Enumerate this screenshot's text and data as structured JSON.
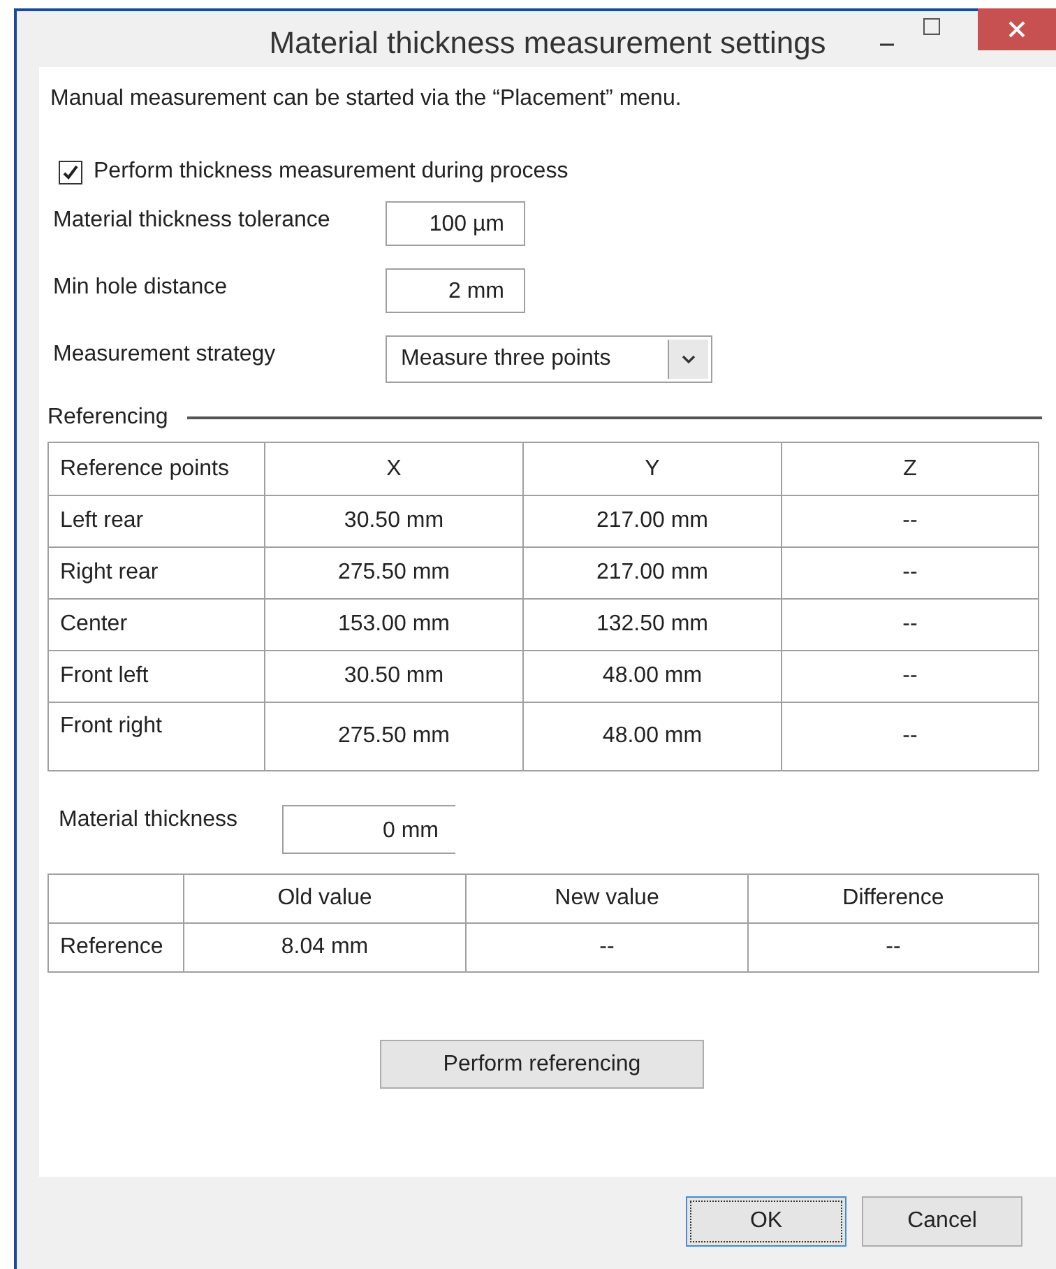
{
  "window": {
    "title": "Material thickness measurement settings"
  },
  "info": "Manual measurement can be started via the “Placement” menu.",
  "perform_check": {
    "label": "Perform thickness measurement during process",
    "checked": true
  },
  "fields": [
    {
      "kind": "input",
      "label": "Material thickness tolerance",
      "value": "100 µm"
    },
    {
      "kind": "input",
      "label": "Min hole distance",
      "value": "2 mm"
    },
    {
      "kind": "dropdown",
      "label": "Measurement strategy",
      "value": "Measure three points"
    }
  ],
  "referencing": {
    "title": "Referencing",
    "columns": [
      "Reference points",
      "X",
      "Y",
      "Z"
    ],
    "rows": [
      [
        "Left rear",
        "30.50 mm",
        "217.00 mm",
        "--"
      ],
      [
        "Right rear",
        "275.50 mm",
        "217.00 mm",
        "--"
      ],
      [
        "Center",
        "153.00 mm",
        "132.50 mm",
        "--"
      ],
      [
        "Front left",
        "30.50 mm",
        "48.00 mm",
        "--"
      ],
      [
        "Front right",
        "275.50 mm",
        "48.00 mm",
        "--"
      ]
    ]
  },
  "material_thickness": {
    "label": "Material thickness",
    "value": "0 mm"
  },
  "thickness_table": {
    "columns": [
      "Old value",
      "New value",
      "Difference"
    ],
    "rows": [
      {
        "label": "Reference",
        "cells": [
          "8.04 mm",
          "--",
          "--"
        ]
      }
    ]
  },
  "referencing_button": "Perform referencing",
  "buttons": [
    {
      "label": "OK",
      "default": true
    },
    {
      "label": "Cancel",
      "default": false
    }
  ]
}
